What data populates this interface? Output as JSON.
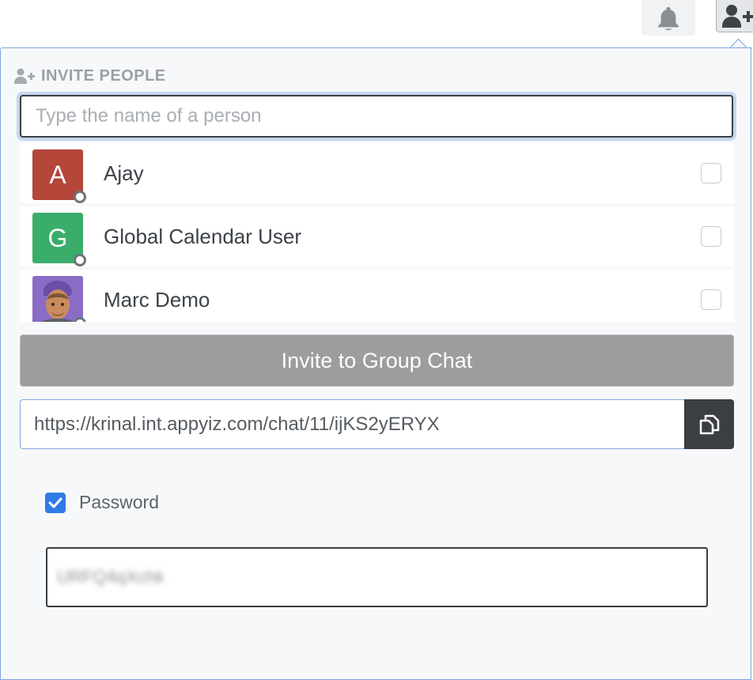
{
  "toolbar": {
    "bell_icon": "bell-icon",
    "invite_icon": "user-plus-icon"
  },
  "popover": {
    "header_icon": "user-plus-icon",
    "title": "INVITE PEOPLE",
    "search": {
      "placeholder": "Type the name of a person",
      "value": ""
    },
    "people": [
      {
        "initial": "A",
        "name": "Ajay",
        "avatar_color": "#b4463a",
        "status": "offline",
        "checked": false
      },
      {
        "initial": "G",
        "name": "Global Calendar User",
        "avatar_color": "#3aad6a",
        "status": "offline",
        "checked": false
      },
      {
        "initial": "",
        "name": "Marc Demo",
        "avatar_color": "#8a6cc4",
        "status": "offline",
        "checked": false
      }
    ],
    "invite_button_label": "Invite to Group Chat",
    "invite_link": "https://krinal.int.appyiz.com/chat/11/ijKS2yERYX",
    "copy_icon": "copy-icon",
    "password": {
      "label": "Password",
      "checked": true,
      "value": "URFQ4qXchk"
    }
  },
  "colors": {
    "accent": "#2f7be5",
    "focus_ring": "#c4d7ee",
    "disabled_button": "#9c9d9e",
    "dark_button": "#3b3e42"
  }
}
